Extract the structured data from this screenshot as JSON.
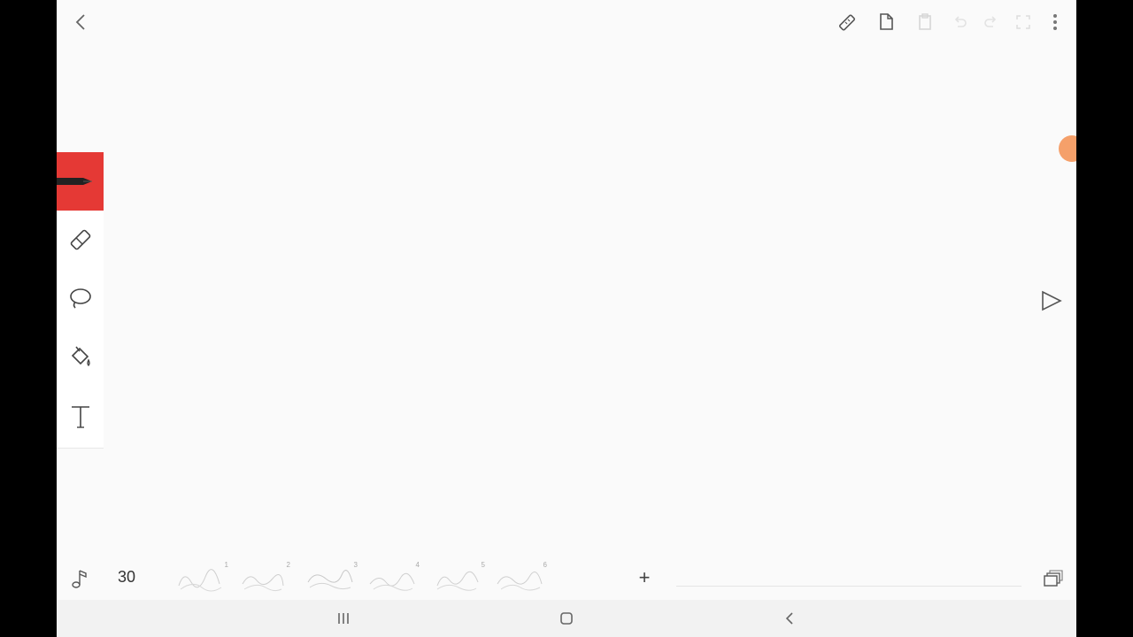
{
  "top_toolbar": {
    "icons": [
      "back-icon",
      "ruler-icon",
      "copy-page-icon",
      "paste-page-icon",
      "undo-icon",
      "redo-icon",
      "fullscreen-icon",
      "more-vertical-icon"
    ]
  },
  "tool_rail": {
    "tools": [
      "pen-icon",
      "eraser-icon",
      "lasso-icon",
      "fill-bucket-icon",
      "text-tool-icon"
    ],
    "active_tool": "pen",
    "active_color": "#e53935"
  },
  "color_picker": {
    "current_color": "#f5a06a"
  },
  "playback": {
    "icon": "play-icon"
  },
  "timeline": {
    "fps": "30",
    "frames": [
      {
        "number": "1"
      },
      {
        "number": "2"
      },
      {
        "number": "3"
      },
      {
        "number": "4"
      },
      {
        "number": "5"
      },
      {
        "number": "6"
      }
    ],
    "add_label": "+"
  },
  "nav_bar": {
    "icons": [
      "recents-icon",
      "home-icon",
      "nav-back-icon"
    ]
  }
}
